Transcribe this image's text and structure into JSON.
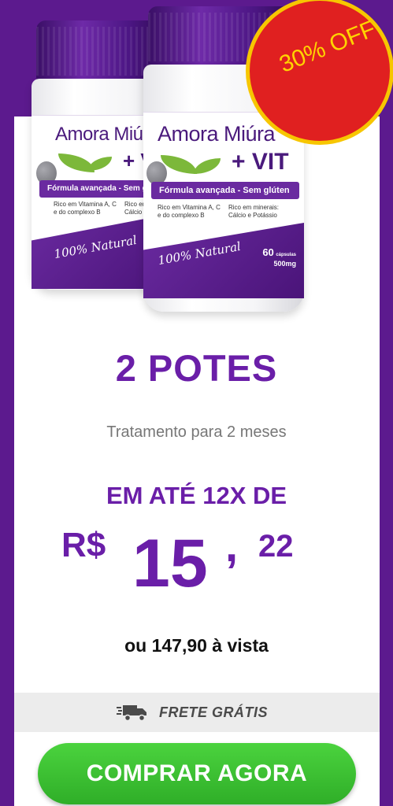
{
  "product": {
    "brand": "Amora Miúra",
    "variant": "+ VIT",
    "formula": "Fórmula avançada - Sem glúten",
    "claim_vitamins": "Rico em Vitamina A, C\ne do complexo B",
    "claim_minerals": "Rico em minerais:\nCálcio e Potássio",
    "natural": "100% Natural",
    "count": "60",
    "count_unit": "cápsulas",
    "dose": "500mg"
  },
  "badge": {
    "text": "30% OFF"
  },
  "offer": {
    "quantity_title": "2 POTES",
    "subtitle": "Tratamento para 2 meses",
    "installment_label": "EM ATÉ 12X DE",
    "currency": "R$",
    "price_integer": "15",
    "price_separator": ",",
    "price_cents": "22",
    "cash_price": "ou 147,90 à vista"
  },
  "shipping": {
    "label": "FRETE GRÁTIS",
    "icon": "truck-icon"
  },
  "cta": {
    "label": "COMPRAR AGORA"
  },
  "colors": {
    "background": "#5c1a8e",
    "accent": "#6a1ea8",
    "badge": "#e02020",
    "badge_text": "#ffd400",
    "cta": "#3cc534"
  }
}
